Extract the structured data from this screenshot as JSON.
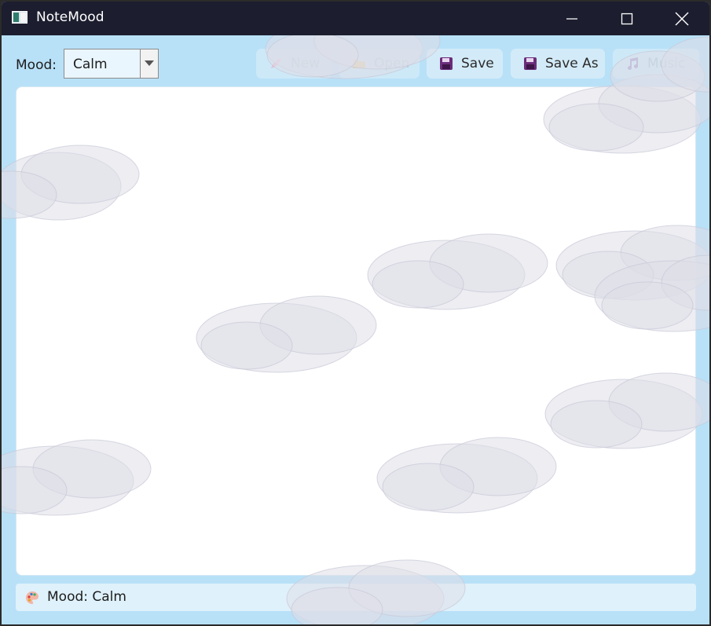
{
  "window": {
    "title": "NoteMood"
  },
  "toolbar": {
    "mood_label": "Mood:",
    "mood_selected": "Calm",
    "buttons": {
      "new": "New",
      "open": "Open",
      "save": "Save",
      "save_as": "Save As",
      "music": "Music"
    }
  },
  "editor": {
    "content": ""
  },
  "status": {
    "text": "Mood: Calm"
  },
  "colors": {
    "titlebar": "#1c1e2f",
    "background": "#b8e1f8",
    "editor": "#ffffff",
    "statusbar": "#dff1fb",
    "save_icon": "#6b2d7a"
  },
  "icons": {
    "app": "app-window-icon",
    "new": "new-note-icon",
    "open": "folder-icon",
    "save": "floppy-disk-icon",
    "save_as": "floppy-disk-icon",
    "music": "music-note-icon",
    "status": "palette-icon"
  }
}
